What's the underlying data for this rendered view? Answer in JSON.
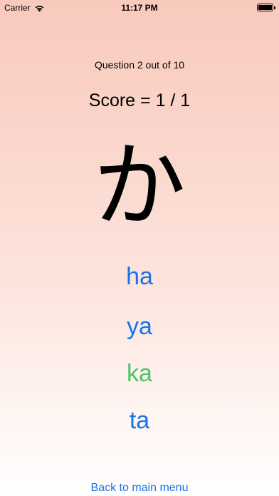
{
  "status_bar": {
    "carrier": "Carrier",
    "time": "11:17 PM",
    "battery_level": 1.0
  },
  "quiz": {
    "question_label": "Question 2 out of 10",
    "score_label": "Score = 1 / 1",
    "character": "か"
  },
  "answers": [
    {
      "label": "ha",
      "state": "default"
    },
    {
      "label": "ya",
      "state": "default"
    },
    {
      "label": "ka",
      "state": "correct"
    },
    {
      "label": "ta",
      "state": "default"
    }
  ],
  "navigation": {
    "back_label": "Back to main menu"
  },
  "colors": {
    "answer_default": "#1a73e8",
    "answer_correct": "#4cc467",
    "gradient_top": "#f9c9bd",
    "gradient_bottom": "#ffffff"
  },
  "icons": {
    "wifi": "wifi-icon",
    "battery": "battery-icon"
  }
}
